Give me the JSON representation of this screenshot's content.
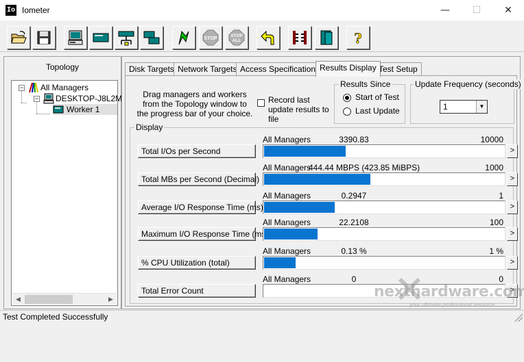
{
  "window": {
    "title": "Iometer",
    "app_icon_text": "Io",
    "min_glyph": "—",
    "max_glyph": "☐",
    "close_glyph": "✕"
  },
  "toolbar": {
    "buttons": [
      {
        "name": "open-config-button",
        "icon": "open-folder-icon"
      },
      {
        "name": "save-config-button",
        "icon": "floppy-disk-icon"
      },
      {
        "name": "new-disk-worker-button",
        "icon": "disk-worker-icon"
      },
      {
        "name": "new-network-worker-button",
        "icon": "network-worker-icon"
      },
      {
        "name": "add-manager-button",
        "icon": "network-manager-icon"
      },
      {
        "name": "copy-worker-button",
        "icon": "copy-worker-icon"
      },
      {
        "name": "start-tests-button",
        "icon": "green-flag-icon"
      },
      {
        "name": "stop-button",
        "icon": "stop-sign-icon",
        "label": "STOP"
      },
      {
        "name": "stop-all-button",
        "icon": "stop-all-sign-icon",
        "label": "STOP",
        "label2": "ALL"
      },
      {
        "name": "reset-workers-button",
        "icon": "reset-arrow-icon"
      },
      {
        "name": "disconnect-button",
        "icon": "disconnect-icon"
      },
      {
        "name": "exit-button",
        "icon": "exit-door-icon"
      },
      {
        "name": "about-button",
        "icon": "question-mark-icon",
        "label": "?"
      }
    ]
  },
  "topology": {
    "heading": "Topology",
    "items": [
      {
        "label": "All Managers",
        "icon": "all-managers-icon",
        "expander": "−"
      },
      {
        "label": "DESKTOP-J8L2M",
        "icon": "computer-icon",
        "expander": "−"
      },
      {
        "label": "Worker 1",
        "icon": "worker-icon"
      }
    ],
    "scroll_left": "◀",
    "scroll_right": "▶"
  },
  "tabs": [
    {
      "label": "Disk Targets",
      "active": false
    },
    {
      "label": "Network Targets",
      "active": false
    },
    {
      "label": "Access Specifications",
      "active": false
    },
    {
      "label": "Results Display",
      "active": true
    },
    {
      "label": "Test Setup",
      "active": false
    }
  ],
  "results": {
    "drag_text": "Drag managers and workers from the Topology window to the progress bar of your choice.",
    "record_label": "Record last update results to file",
    "record_checked": false,
    "since_title": "Results Since",
    "since_options": [
      {
        "label": "Start of Test",
        "selected": true
      },
      {
        "label": "Last Update",
        "selected": false
      }
    ],
    "update_freq_title": "Update Frequency (seconds)",
    "update_freq_value": "1",
    "display_title": "Display",
    "more_glyph": ">",
    "metrics": [
      {
        "button": "Total I/Os per Second",
        "manager": "All Managers",
        "value": "3390.83",
        "max": "10000",
        "fraction": 0.339
      },
      {
        "button": "Total MBs per Second (Decimal)",
        "manager": "All Managers",
        "value": "444.44 MBPS (423.85 MiBPS)",
        "max": "1000",
        "fraction": 0.444
      },
      {
        "button": "Average I/O Response Time (ms)",
        "manager": "All Managers",
        "value": "0.2947",
        "max": "1",
        "fraction": 0.295
      },
      {
        "button": "Maximum I/O Response Time (ms)",
        "manager": "All Managers",
        "value": "22.2108",
        "max": "100",
        "fraction": 0.222
      },
      {
        "button": "% CPU Utilization (total)",
        "manager": "All Managers",
        "value": "0.13 %",
        "max": "1 %",
        "fraction": 0.13
      },
      {
        "button": "Total Error Count",
        "manager": "All Managers",
        "value": "0",
        "max": "0",
        "fraction": 0
      }
    ]
  },
  "status": {
    "text": "Test Completed Successfully"
  },
  "watermark": {
    "brand": "nexthardware.com",
    "tagline": "your ultimate professional resource"
  },
  "colors": {
    "bar_fill": "#0a75d0",
    "window_bg": "#f0f0f0"
  }
}
